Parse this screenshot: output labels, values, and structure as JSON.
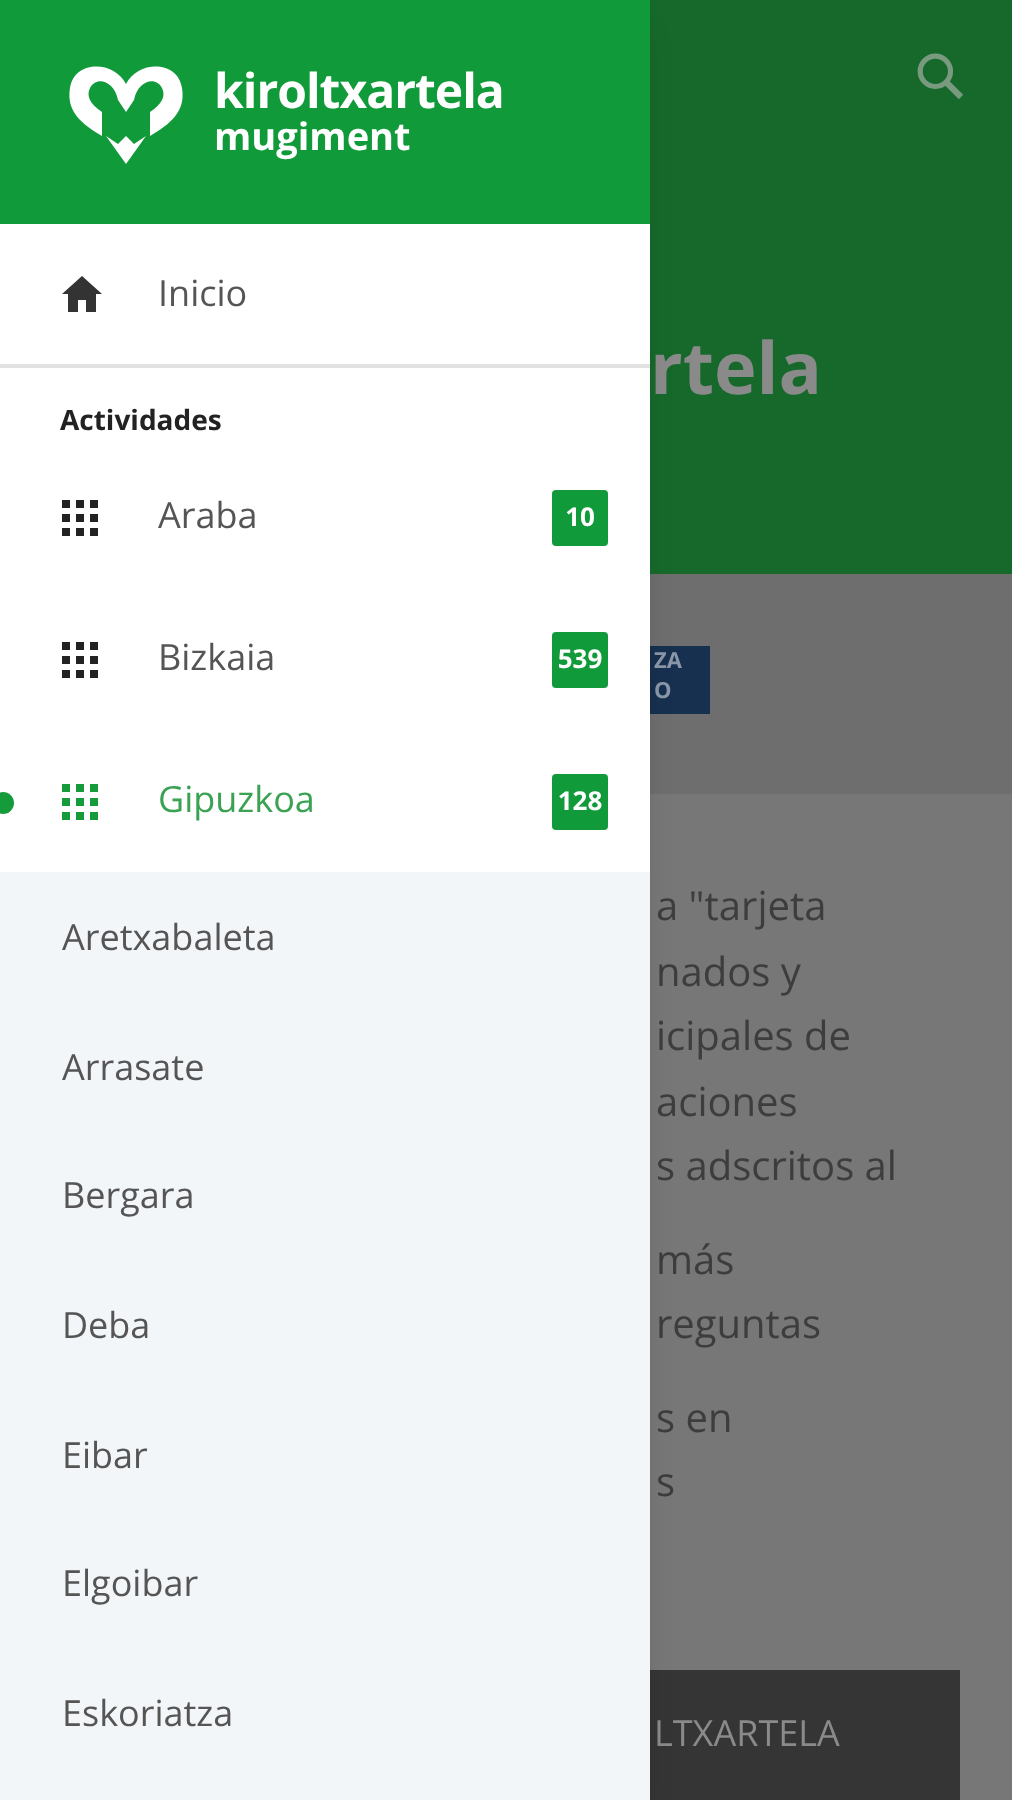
{
  "app_bar": {
    "title_fragment": "rtela"
  },
  "banner": {
    "lines": [
      "ZA",
      "O"
    ]
  },
  "body": {
    "paragraphs": [
      [
        "a \"tarjeta",
        "nados y",
        "icipales de",
        "aciones",
        "s adscritos al"
      ],
      [
        "más",
        "reguntas"
      ],
      [
        "s en",
        "s"
      ]
    ]
  },
  "button": {
    "label": "LTXARTELA"
  },
  "drawer": {
    "logo": {
      "name": "kiroltxartela",
      "subtitle": "mugiment"
    },
    "home": {
      "label": "Inicio"
    },
    "section_title": "Actividades",
    "provinces": [
      {
        "label": "Araba",
        "count": "10",
        "selected": false
      },
      {
        "label": "Bizkaia",
        "count": "539",
        "selected": false
      },
      {
        "label": "Gipuzkoa",
        "count": "128",
        "selected": true
      }
    ],
    "towns": [
      "Aretxabaleta",
      "Arrasate",
      "Bergara",
      "Deba",
      "Eibar",
      "Elgoibar",
      "Eskoriatza"
    ]
  }
}
